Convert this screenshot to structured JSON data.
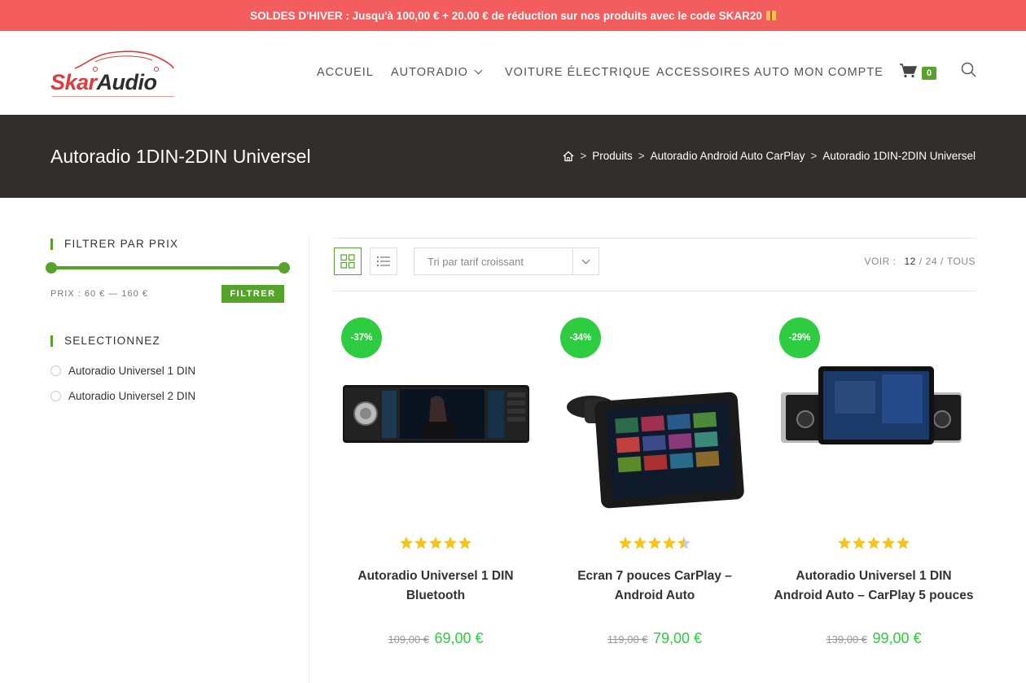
{
  "promo": {
    "text": "SOLDES D'HIVER : Jusqu'à 100,00 € + 20.00 € de réduction sur nos produits avec le code SKAR20"
  },
  "brand": {
    "part1": "Skar",
    "part2": "Audio",
    "accent": "#e03a3a"
  },
  "nav": {
    "items": [
      "ACCUEIL",
      "AUTORADIO",
      "VOITURE ÉLECTRIQUE",
      "ACCESSOIRES AUTO",
      "MON COMPTE"
    ],
    "cart_count": "0"
  },
  "page": {
    "title": "Autoradio 1DIN-2DIN Universel",
    "breadcrumb": [
      "Produits",
      "Autoradio Android Auto CarPlay",
      "Autoradio 1DIN-2DIN Universel"
    ]
  },
  "sidebar": {
    "price_filter_title": "FILTRER PAR PRIX",
    "price_label": "PRIX : 60 € — 160 €",
    "filter_button": "FILTRER",
    "select_title": "SELECTIONNEZ",
    "categories": [
      "Autoradio Universel 1 DIN",
      "Autoradio Universel 2 DIN"
    ]
  },
  "toolbar": {
    "sort_label": "Tri par tarif croissant",
    "voir_label": "VOIR :",
    "voir_options": [
      "12",
      "/",
      "24",
      "/",
      "TOUS"
    ]
  },
  "products": [
    {
      "badge": "-37%",
      "title": "Autoradio Universel 1 DIN Bluetooth",
      "old_price": "109,00 €",
      "new_price": "69,00 €",
      "rating": 5
    },
    {
      "badge": "-34%",
      "title": "Ecran 7 pouces CarPlay – Android Auto",
      "old_price": "119,00 €",
      "new_price": "79,00 €",
      "rating": 4.5
    },
    {
      "badge": "-29%",
      "title": "Autoradio Universel 1 DIN Android Auto – CarPlay 5 pouces",
      "old_price": "139,00 €",
      "new_price": "99,00 €",
      "rating": 5
    }
  ],
  "colors": {
    "green": "#55a32a",
    "badge_green": "#2ecc40",
    "promo_red": "#f35d5d",
    "band": "#332e2e",
    "star": "#f5c518"
  }
}
